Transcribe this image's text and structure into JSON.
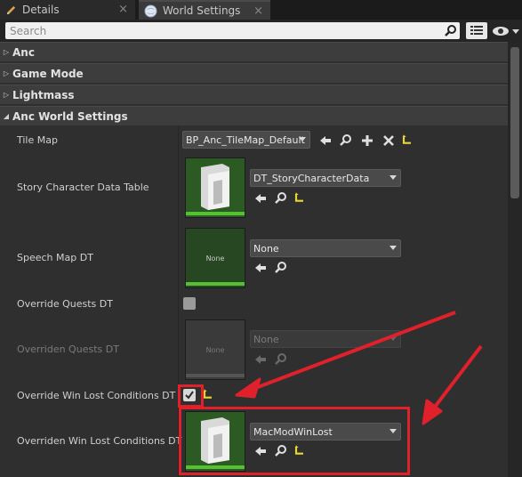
{
  "tabs": [
    {
      "label": "Details",
      "icon": "pencil-icon"
    },
    {
      "label": "World Settings",
      "icon": "globe-icon"
    }
  ],
  "search": {
    "placeholder": "Search"
  },
  "categories": [
    "Anc",
    "Game Mode",
    "Lightmass",
    "Anc World Settings"
  ],
  "properties": {
    "tile_map": {
      "label": "Tile Map",
      "value": "BP_Anc_TileMap_Default"
    },
    "story_character": {
      "label": "Story Character Data Table",
      "value": "DT_StoryCharacterData"
    },
    "speech_map": {
      "label": "Speech Map DT",
      "value": "None",
      "thumb_text": "None"
    },
    "override_quests": {
      "label": "Override Quests DT",
      "checked": false
    },
    "overriden_quests": {
      "label": "Overriden Quests DT",
      "value": "None",
      "thumb_text": "None"
    },
    "override_win_lost": {
      "label": "Override Win Lost Conditions DT",
      "checked": true
    },
    "overriden_win_lost": {
      "label": "Overriden Win Lost Conditions DT",
      "value": "MacModWinLost"
    }
  },
  "colors": {
    "accent_green": "#54c132",
    "highlight_red": "#e0202a",
    "reset_yellow": "#e8d832"
  }
}
